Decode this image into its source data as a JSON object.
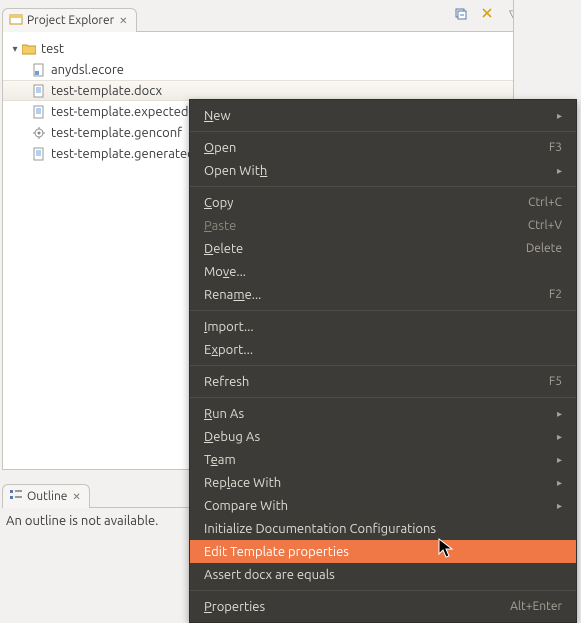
{
  "explorer": {
    "title": "Project Explorer",
    "toolbar": {
      "collapse": "⊟",
      "link": "↬",
      "menu": "▽",
      "min": "─",
      "max": "▭"
    },
    "tree": {
      "root": "test",
      "files": [
        {
          "name": "anydsl.ecore",
          "icon": "ecore"
        },
        {
          "name": "test-template.docx",
          "icon": "doc",
          "selected": true
        },
        {
          "name": "test-template.expected-generation.docx",
          "icon": "doc"
        },
        {
          "name": "test-template.genconf",
          "icon": "gear"
        },
        {
          "name": "test-template.generated.docx",
          "icon": "doc"
        }
      ]
    }
  },
  "outline": {
    "title": "Outline",
    "message": "An outline is not available."
  },
  "context_menu": {
    "items": [
      {
        "label": "New",
        "mn": "N",
        "submenu": true
      },
      {
        "sep": true
      },
      {
        "label": "Open",
        "mn": "O",
        "accel": "F3"
      },
      {
        "label": "Open With",
        "mn": "h",
        "submenu": true
      },
      {
        "sep": true
      },
      {
        "label": "Copy",
        "mn": "C",
        "accel": "Ctrl+C"
      },
      {
        "label": "Paste",
        "mn": "P",
        "accel": "Ctrl+V",
        "disabled": true
      },
      {
        "label": "Delete",
        "mn": "D",
        "accel": "Delete"
      },
      {
        "label": "Move...",
        "mn": "v"
      },
      {
        "label": "Rename...",
        "mn": "m",
        "accel": "F2"
      },
      {
        "sep": true
      },
      {
        "label": "Import...",
        "mn": "I"
      },
      {
        "label": "Export...",
        "mn": "x"
      },
      {
        "sep": true
      },
      {
        "label": "Refresh",
        "mn": "F",
        "accel": "F5"
      },
      {
        "sep": true
      },
      {
        "label": "Run As",
        "mn": "R",
        "submenu": true
      },
      {
        "label": "Debug As",
        "mn": "D",
        "submenu": true
      },
      {
        "label": "Team",
        "mn": "e",
        "submenu": true
      },
      {
        "label": "Replace With",
        "mn": "l",
        "submenu": true
      },
      {
        "label": "Compare With",
        "submenu": true
      },
      {
        "label": "Initialize Documentation Configurations"
      },
      {
        "label": "Edit Template properties",
        "highlight": true
      },
      {
        "label": "Assert docx are equals"
      },
      {
        "sep": true
      },
      {
        "label": "Properties",
        "mn": "P",
        "accel": "Alt+Enter"
      }
    ]
  }
}
